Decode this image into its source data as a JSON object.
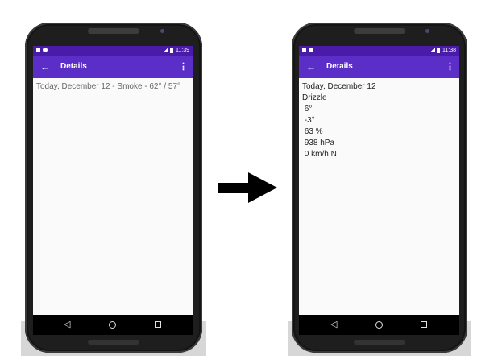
{
  "left_phone": {
    "status": {
      "time": "11:39"
    },
    "appbar": {
      "back": "←",
      "title": "Details",
      "menu": "⋮"
    },
    "content": {
      "line": "Today, December 12 - Smoke -  62°  / 57°"
    }
  },
  "right_phone": {
    "status": {
      "time": "11:38"
    },
    "appbar": {
      "back": "←",
      "title": "Details",
      "menu": "⋮"
    },
    "content": {
      "date": "Today, December 12",
      "condition": "Drizzle",
      "high": " 6°",
      "low": " -3°",
      "humidity": " 63 %",
      "pressure": " 938 hPa",
      "wind": " 0 km/h N"
    }
  },
  "navbar": {
    "back": "◁",
    "home": "○",
    "recent": "□"
  },
  "icons": [
    "arrow-left-icon",
    "overflow-menu-icon",
    "nav-back-icon",
    "nav-home-icon",
    "nav-recent-icon",
    "transition-arrow-icon"
  ]
}
